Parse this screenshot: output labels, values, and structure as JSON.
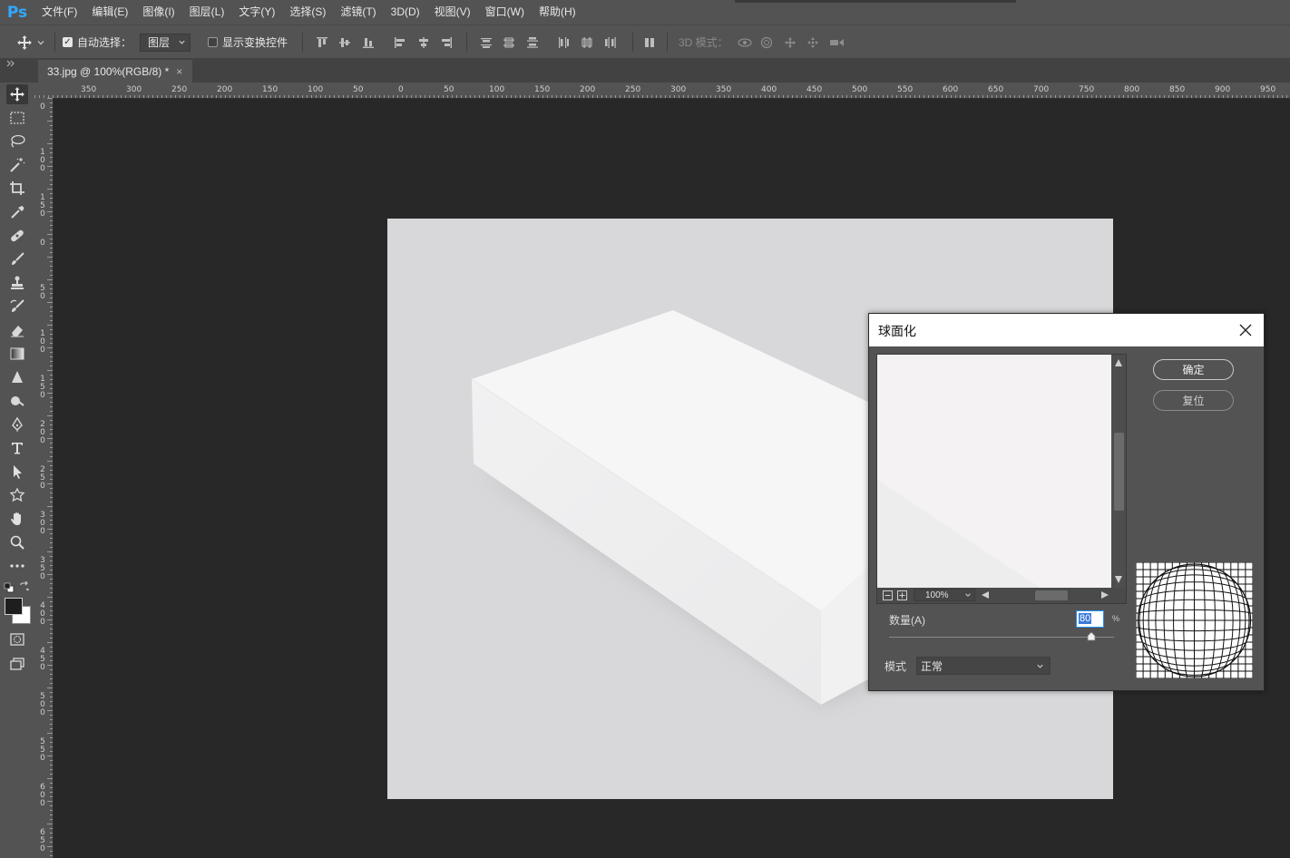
{
  "app": {
    "logo": "Ps"
  },
  "menu": [
    "文件(F)",
    "编辑(E)",
    "图像(I)",
    "图层(L)",
    "文字(Y)",
    "选择(S)",
    "滤镜(T)",
    "3D(D)",
    "视图(V)",
    "窗口(W)",
    "帮助(H)"
  ],
  "options": {
    "auto_select_label": "自动选择：",
    "auto_select_checked": true,
    "auto_select_target": "图层",
    "show_transform_label": "显示变换控件",
    "show_transform_checked": false,
    "mode_3d_label": "3D 模式："
  },
  "tab": {
    "title": "33.jpg @ 100%(RGB/8) *",
    "close": "×"
  },
  "rulers": {
    "top": [
      "350",
      "300",
      "250",
      "200",
      "150",
      "100",
      "50",
      "0",
      "50",
      "100",
      "150",
      "200",
      "250",
      "300",
      "350",
      "400",
      "450",
      "500",
      "550",
      "600",
      "650",
      "700",
      "750",
      "800",
      "850",
      "900",
      "950"
    ],
    "left": [
      "0",
      "100",
      "150",
      "0",
      "50",
      "100",
      "150",
      "200",
      "250",
      "300",
      "350",
      "400",
      "450",
      "500",
      "550",
      "600",
      "650"
    ]
  },
  "tools": [
    "move-tool",
    "marquee-tool",
    "lasso-tool",
    "magic-wand-tool",
    "crop-tool",
    "eyedropper-tool",
    "healing-brush-tool",
    "brush-tool",
    "clone-stamp-tool",
    "history-brush-tool",
    "eraser-tool",
    "gradient-tool",
    "blur-tool",
    "dodge-tool",
    "pen-tool",
    "type-tool",
    "path-selection-tool",
    "shape-tool",
    "hand-tool",
    "zoom-tool",
    "more-tools"
  ],
  "colors": {
    "foreground": "#1e1e1e",
    "background": "#ffffff",
    "accent": "#31a8ff"
  },
  "dialog": {
    "title": "球面化",
    "ok_label": "确定",
    "reset_label": "复位",
    "zoom": "100%",
    "amount_label": "数量(A)",
    "amount_value": "80",
    "amount_unit": "%",
    "amount_slider_value": 80,
    "mode_label": "模式",
    "mode_value": "正常"
  }
}
